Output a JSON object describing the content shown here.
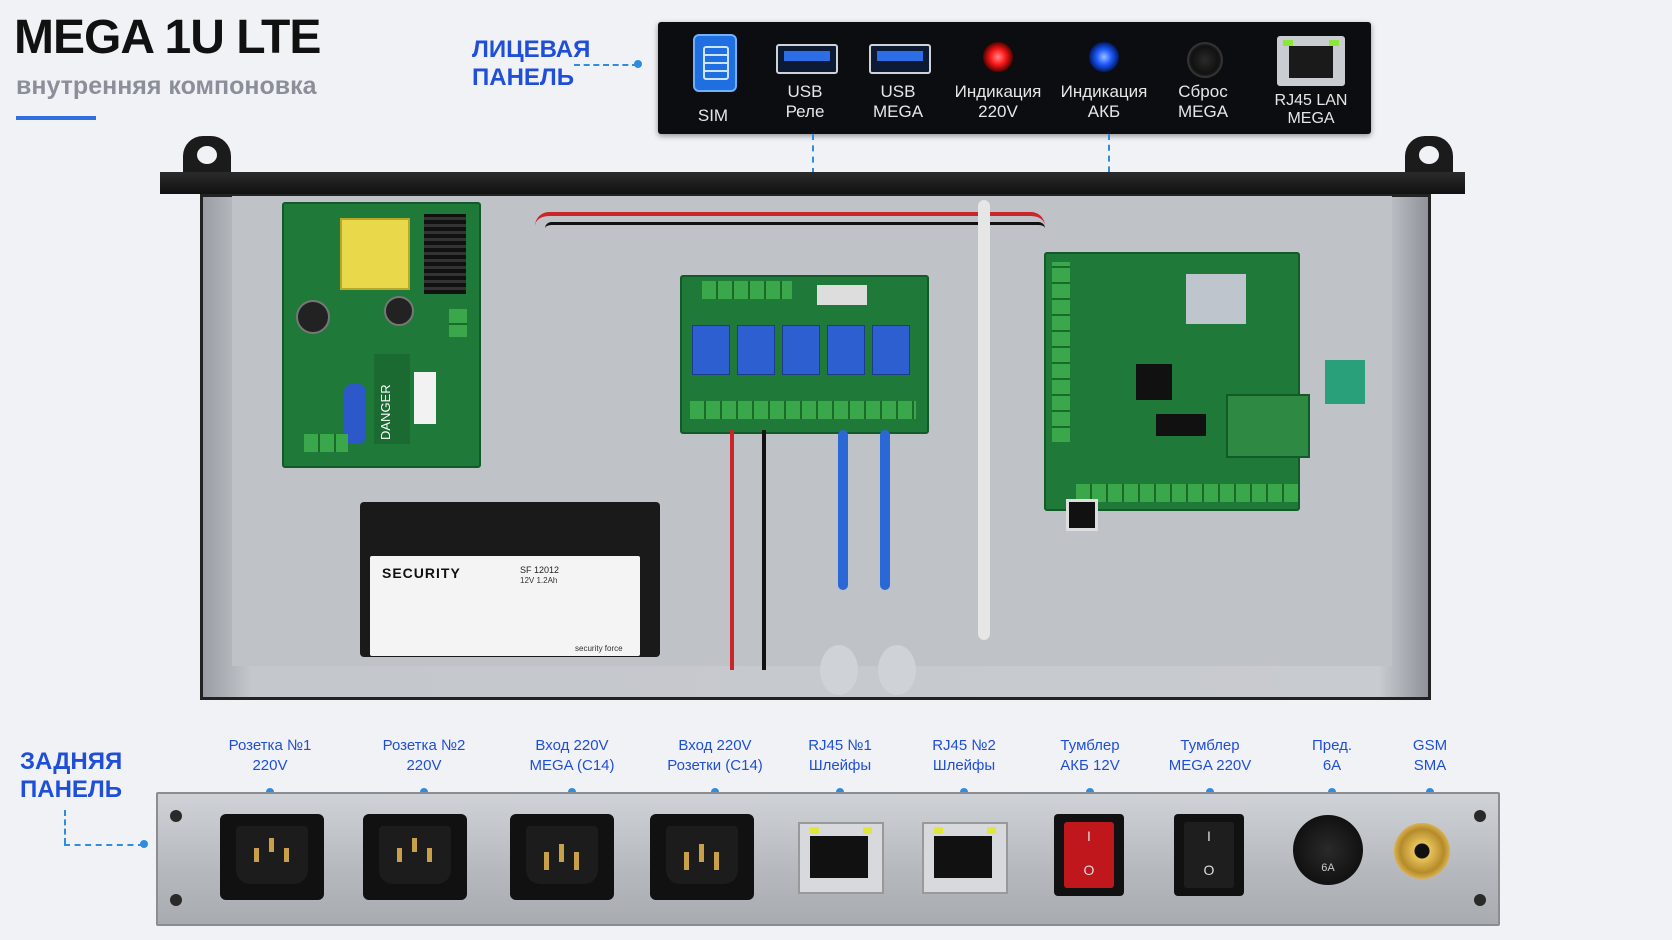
{
  "header": {
    "title": "MEGA 1U LTE",
    "subtitle": "внутренняя компоновка",
    "accent_color": "#1f4fd8"
  },
  "front_panel": {
    "section_label_line1": "ЛИЦЕВАЯ",
    "section_label_line2": "ПАНЕЛЬ",
    "items": [
      {
        "label": "SIM",
        "icon": "sim-card-icon"
      },
      {
        "label_line1": "USB",
        "label_line2": "Реле",
        "icon": "usb-port-icon"
      },
      {
        "label_line1": "USB",
        "label_line2": "MEGA",
        "icon": "usb-port-icon"
      },
      {
        "label_line1": "Индикация",
        "label_line2": "220V",
        "icon": "red-led-icon"
      },
      {
        "label_line1": "Индикация",
        "label_line2": "АКБ",
        "icon": "blue-led-icon"
      },
      {
        "label_line1": "Сброс",
        "label_line2": "MEGA",
        "icon": "reset-button-icon"
      },
      {
        "label_line1": "RJ45 LAN",
        "label_line2": "MEGA",
        "icon": "rj45-port-icon"
      }
    ]
  },
  "internals": {
    "board_text": "DANGER",
    "battery": {
      "brand": "SECURITY",
      "model": "SF 12012",
      "spec": "12V 1.2Ah",
      "footer": "security force"
    }
  },
  "rear_panel": {
    "section_label_line1": "ЗАДНЯЯ",
    "section_label_line2": "ПАНЕЛЬ",
    "items": [
      {
        "label_line1": "Розетка №1",
        "label_line2": "220V",
        "icon": "c13-socket-icon"
      },
      {
        "label_line1": "Розетка №2",
        "label_line2": "220V",
        "icon": "c13-socket-icon"
      },
      {
        "label_line1": "Вход 220V",
        "label_line2": "MEGA (C14)",
        "icon": "c14-inlet-icon"
      },
      {
        "label_line1": "Вход 220V",
        "label_line2": "Розетки (C14)",
        "icon": "c14-inlet-icon"
      },
      {
        "label_line1": "RJ45 №1",
        "label_line2": "Шлейфы",
        "icon": "rj45-port-icon"
      },
      {
        "label_line1": "RJ45 №2",
        "label_line2": "Шлейфы",
        "icon": "rj45-port-icon"
      },
      {
        "label_line1": "Тумблер",
        "label_line2": "АКБ 12V",
        "icon": "red-rocker-switch-icon"
      },
      {
        "label_line1": "Тумблер",
        "label_line2": "MEGA 220V",
        "icon": "black-rocker-switch-icon"
      },
      {
        "label_line1": "Пред.",
        "label_line2": "6А",
        "icon": "fuse-holder-icon"
      },
      {
        "label_line1": "GSM",
        "label_line2": "SMA",
        "icon": "sma-connector-icon"
      }
    ],
    "fuse_marking": "6A",
    "switch_on_mark": "I",
    "switch_off_mark": "O"
  }
}
